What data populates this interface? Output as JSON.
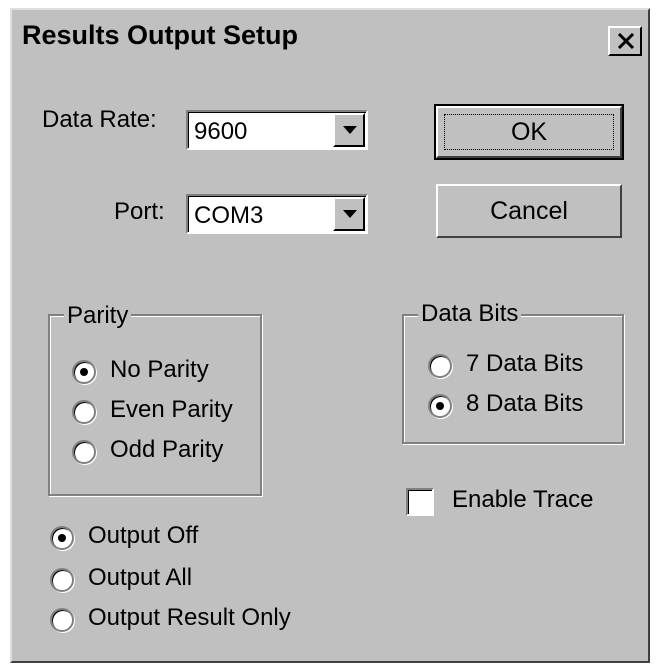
{
  "window": {
    "title": "Results Output Setup"
  },
  "data_rate": {
    "label": "Data Rate:",
    "value": "9600"
  },
  "port": {
    "label": "Port:",
    "value": "COM3"
  },
  "buttons": {
    "ok": "OK",
    "cancel": "Cancel"
  },
  "parity": {
    "legend": "Parity",
    "options": [
      "No Parity",
      "Even Parity",
      "Odd Parity"
    ],
    "selected": "No Parity"
  },
  "data_bits": {
    "legend": "Data Bits",
    "options": [
      "7 Data Bits",
      "8 Data Bits"
    ],
    "selected": "8 Data Bits"
  },
  "enable_trace": {
    "label": "Enable Trace",
    "checked": false
  },
  "output": {
    "options": [
      "Output Off",
      "Output All",
      "Output Result Only"
    ],
    "selected": "Output Off"
  }
}
